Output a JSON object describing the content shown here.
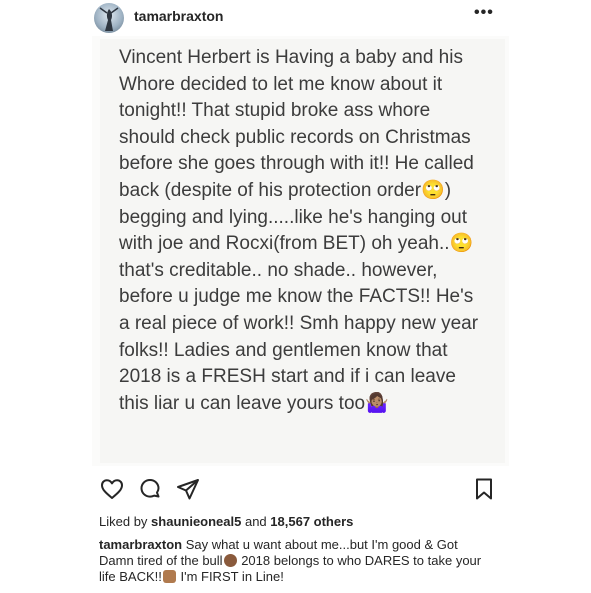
{
  "header": {
    "username": "tamarbraxton",
    "more_label": "•••"
  },
  "post_image": {
    "text": "Vincent Herbert is Having a baby and his\nWhore decided to let me know about it\ntonight!! That stupid broke ass whore\nshould check public records on Christmas\nbefore she goes through with it!! He called\nback (despite of his protection order🙄)\nbegging and lying.....like he's hanging out\nwith joe and Rocxi(from BET) oh yeah..🙄\nthat's creditable.. no shade.. however,\nbefore u judge me know the FACTS!! He's\na real piece of work!! Smh happy new year\nfolks!! Ladies and gentlemen know that\n2018 is a FRESH start and if i can leave\nthis liar u can leave yours too🤷🏽‍♀️"
  },
  "actions": {
    "like_icon": "heart-icon",
    "comment_icon": "comment-icon",
    "share_icon": "share-icon",
    "save_icon": "bookmark-icon"
  },
  "likes": {
    "prefix": "Liked by ",
    "user": "shaunieoneal5",
    "middle": " and ",
    "count": "18,567 others"
  },
  "caption": {
    "username": "tamarbraxton",
    "part1": " Say what u want about me...but I'm good & Got Damn tired of the bull",
    "part2": " 2018 belongs to who DARES to take your life BACK!!",
    "part3": " I'm FIRST in Line!"
  },
  "colors": {
    "text": "#262626",
    "photo_bg": "#f6f6f4",
    "note_text": "#3c3c3c"
  }
}
